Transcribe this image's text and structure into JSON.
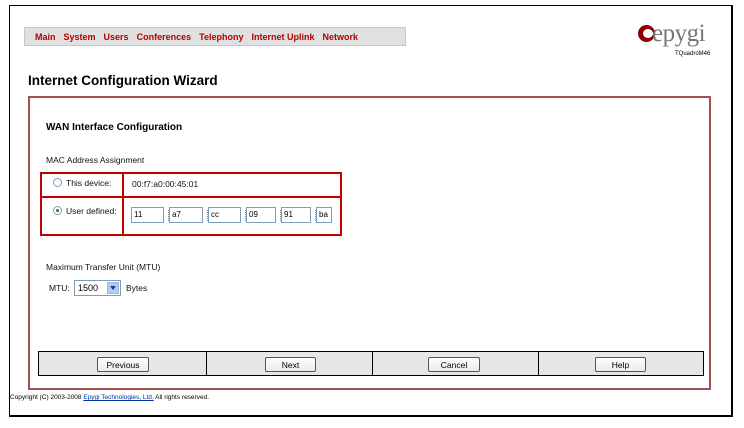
{
  "menu": {
    "items": [
      "Main",
      "System",
      "Users",
      "Conferences",
      "Telephony",
      "Internet Uplink",
      "Network"
    ]
  },
  "logo": {
    "brand": "epygi",
    "model": "TQuadroM46"
  },
  "page_title": "Internet Configuration Wizard",
  "wan": {
    "section_title": "WAN Interface Configuration",
    "mac_label": "MAC Address Assignment",
    "this_device_label": "This device:",
    "this_device_value": "00:f7:a0:00:45:01",
    "user_defined_label": "User defined:",
    "user_defined_values": [
      "11",
      "a7",
      "cc",
      "09",
      "91",
      "ba"
    ],
    "selected_option": "User defined",
    "mtu_section_label": "Maximum Transfer Unit (MTU)",
    "mtu_label": "MTU:",
    "mtu_value": "1500",
    "mtu_unit": "Bytes"
  },
  "buttons": {
    "previous": "Previous",
    "next": "Next",
    "cancel": "Cancel",
    "help": "Help"
  },
  "footer": {
    "copyright_prefix": "Copyright (C) 2003-2008",
    "copyright_link": "Epygi Technologies, Ltd.",
    "copyright_suffix": "All rights reserved."
  },
  "colors": {
    "menu_text": "#b40000",
    "panel_border": "#a05050",
    "highlight_border": "#c00000",
    "logo_mark": "#8a0000"
  }
}
